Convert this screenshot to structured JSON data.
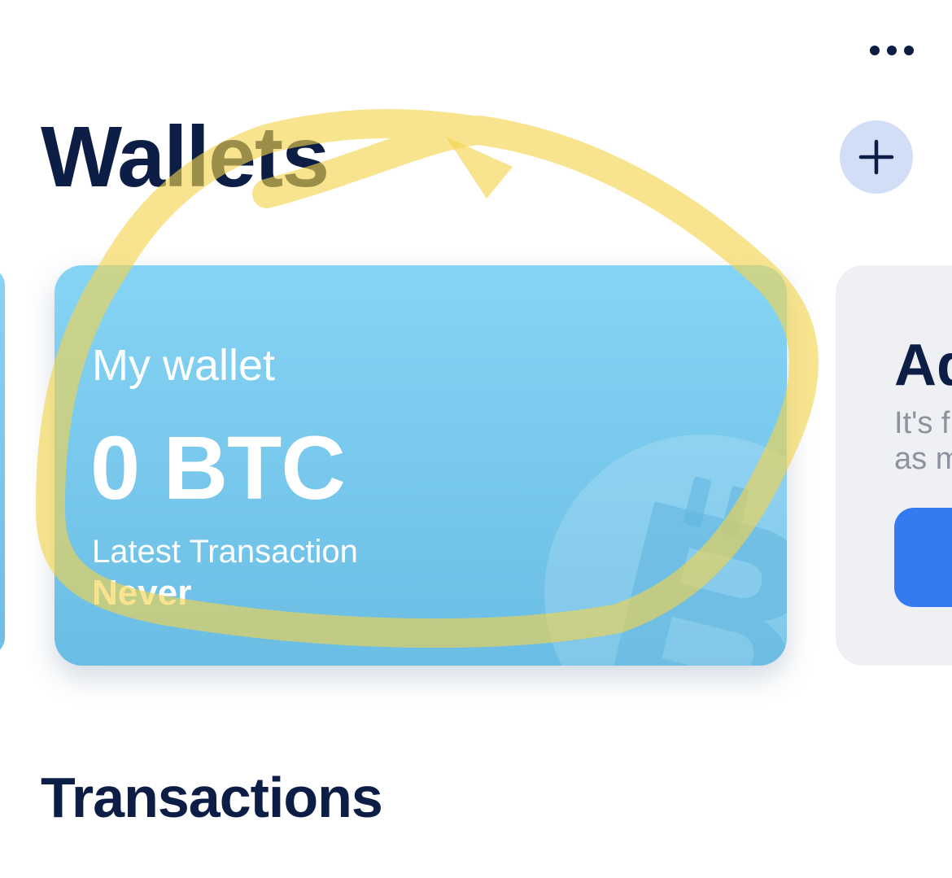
{
  "header": {
    "more_icon": "more-horizontal-icon",
    "title": "Wallets",
    "add_icon": "plus-icon"
  },
  "wallets": [
    {
      "label": "My wallet",
      "balance": "0 BTC",
      "latest_transaction_label": "Latest Transaction",
      "latest_transaction_value": "Never",
      "watermark_icon": "bitcoin-icon"
    }
  ],
  "promo_card": {
    "title": "Ad",
    "text_line1": "It's f",
    "text_line2": "as m"
  },
  "sections": {
    "transactions_title": "Transactions"
  },
  "colors": {
    "title_navy": "#0c1e46",
    "card_blue_top": "#86d4f5",
    "card_blue_bottom": "#6abde4",
    "add_button_bg": "#d2def6",
    "promo_bg": "#eef0f4",
    "promo_button": "#347bf2",
    "highlight_yellow": "#f4d44a"
  }
}
